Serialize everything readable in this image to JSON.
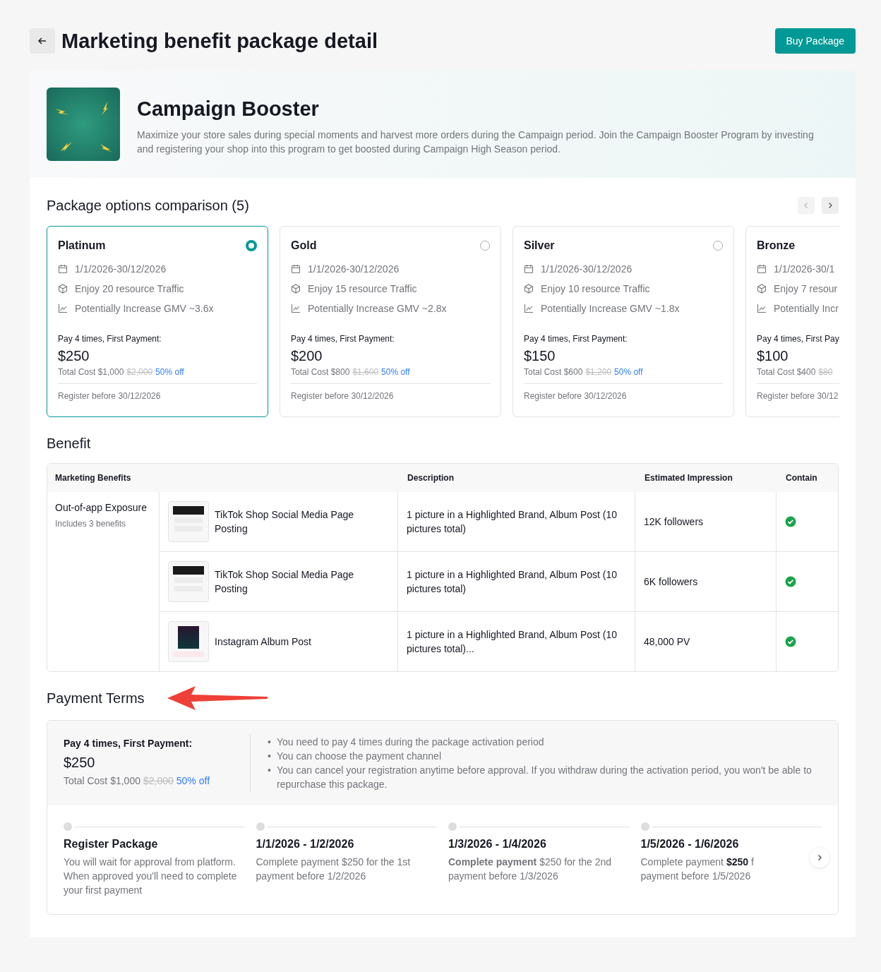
{
  "header": {
    "title": "Marketing benefit package detail",
    "buy_button": "Buy Package"
  },
  "campaign": {
    "title": "Campaign Booster",
    "description": "Maximize your store sales during special moments and harvest more orders during the Campaign period. Join the Campaign Booster Program by investing and registering your shop into this program to get boosted during Campaign High Season period."
  },
  "options": {
    "title": "Package options comparison (5)",
    "cards": [
      {
        "name": "Platinum",
        "selected": true,
        "date": "1/1/2026-30/12/2026",
        "traffic": "Enjoy 20 resource Traffic",
        "gmv": "Potentially Increase GMV ~3.6x",
        "pay_label": "Pay 4 times, First Payment:",
        "price": "$250",
        "total": "Total Cost $1,000",
        "original": "$2,000",
        "discount": "50% off",
        "register": "Register before 30/12/2026"
      },
      {
        "name": "Gold",
        "selected": false,
        "date": "1/1/2026-30/12/2026",
        "traffic": "Enjoy 15 resource Traffic",
        "gmv": "Potentially Increase GMV ~2.8x",
        "pay_label": "Pay 4 times, First Payment:",
        "price": "$200",
        "total": "Total Cost $800",
        "original": "$1,600",
        "discount": "50% off",
        "register": "Register before 30/12/2026"
      },
      {
        "name": "Silver",
        "selected": false,
        "date": "1/1/2026-30/12/2026",
        "traffic": "Enjoy 10 resource Traffic",
        "gmv": "Potentially Increase GMV ~1.8x",
        "pay_label": "Pay 4 times, First Payment:",
        "price": "$150",
        "total": "Total Cost $600",
        "original": "$1,200",
        "discount": "50% off",
        "register": "Register before 30/12/2026"
      },
      {
        "name": "Bronze",
        "selected": false,
        "date": "1/1/2026-30/1",
        "traffic": "Enjoy 7 resour",
        "gmv": "Potentially Incr",
        "pay_label": "Pay 4 times, First Pay",
        "price": "$100",
        "total": "Total Cost $400",
        "original": "$80",
        "register": "Register before 30/12"
      }
    ]
  },
  "benefit": {
    "title": "Benefit",
    "columns": [
      "Marketing Benefits",
      "Description",
      "Estimated Impression",
      "Contain"
    ],
    "group": {
      "name": "Out-of-app Exposure",
      "note": "Includes 3 benefits"
    },
    "rows": [
      {
        "name": "TikTok Shop Social Media Page Posting",
        "kind": "page",
        "description": "1 picture in a Highlighted Brand, Album Post (10 pictures total)",
        "impression": "12K followers",
        "contained": true
      },
      {
        "name": "TikTok Shop Social Media Page Posting",
        "kind": "page",
        "description": "1 picture in a Highlighted Brand, Album Post (10 pictures total)",
        "impression": "6K followers",
        "contained": true
      },
      {
        "name": "Instagram Album Post",
        "kind": "poster",
        "description": "1 picture in a Highlighted Brand, Album Post (10 pictures total)...",
        "impression": "48,000 PV",
        "contained": true
      }
    ]
  },
  "payment_terms": {
    "title": "Payment Terms",
    "pay_label": "Pay 4 times, First Payment:",
    "price": "$250",
    "total": "Total Cost $1,000",
    "original": "$2,000",
    "discount": "50% off",
    "bullet": "•",
    "notes": [
      "You need to pay 4 times during the package activation period",
      "You can choose the payment channel",
      "You can cancel your registration anytime before approval. If you withdraw during the activation period, you won't be able to repurchase this package."
    ],
    "steps": [
      {
        "title": "Register Package",
        "description": "You will wait for approval from platform. When approved you'll need to complete your first payment"
      },
      {
        "title": "1/1/2026 - 1/2/2026",
        "description": "Complete payment $250 for the 1st payment before 1/2/2026"
      },
      {
        "title": "1/3/2026 - 1/4/2026",
        "description": "**Complete payment** $250 for the 2nd payment before 1/3/2026"
      },
      {
        "title": "1/5/2026 - 1/6/2026",
        "description": "Complete payment **$250** f\npayment before 1/5/2026"
      }
    ]
  }
}
